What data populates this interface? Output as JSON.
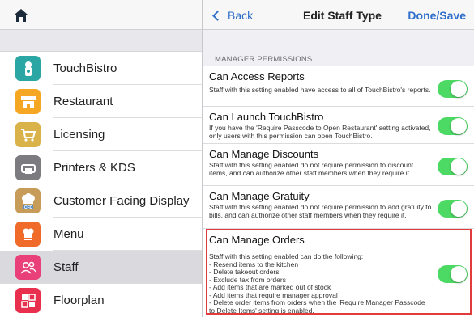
{
  "sidebar": {
    "home_icon": "house-icon",
    "items": [
      {
        "label": "TouchBistro",
        "icon": "chef-badge-icon",
        "color": "#2aa6a5"
      },
      {
        "label": "Restaurant",
        "icon": "store-icon",
        "color": "#f5a623"
      },
      {
        "label": "Licensing",
        "icon": "cart-icon",
        "color": "#d9b24a"
      },
      {
        "label": "Printers & KDS",
        "icon": "printer-icon",
        "color": "#7b7b80"
      },
      {
        "label": "Customer Facing Display",
        "icon": "cfd-chef-icon",
        "color": "#c79b58"
      },
      {
        "label": "Menu",
        "icon": "menu-chef-icon",
        "color": "#f06a2a"
      },
      {
        "label": "Staff",
        "icon": "staff-icon",
        "color": "#e9407a"
      },
      {
        "label": "Floorplan",
        "icon": "floorplan-icon",
        "color": "#e8304e"
      }
    ],
    "active_index": 6
  },
  "header": {
    "back_label": "Back",
    "title": "Edit Staff Type",
    "done_label": "Done/Save"
  },
  "section": {
    "title": "MANAGER PERMISSIONS"
  },
  "permissions": [
    {
      "title": "Can Access Reports",
      "desc": "Staff with this setting enabled have access to all of TouchBistro's reports.",
      "enabled": true
    },
    {
      "title": "Can Launch TouchBistro",
      "desc": "If you have the 'Require Passcode to Open Restaurant' setting activated, only users with this permission can open TouchBistro.",
      "enabled": true
    },
    {
      "title": "Can Manage Discounts",
      "desc": "Staff with this setting enabled do not require permission to discount items, and can authorize other staff members when they require it.",
      "enabled": true
    },
    {
      "title": "Can Manage Gratuity",
      "desc": "Staff with this setting enabled do not require permission to add gratuity to bills, and can authorize other staff members when they require it.",
      "enabled": true
    },
    {
      "title": "Can Manage Orders",
      "desc": "Staff with this setting enabled can do the following:",
      "enabled": true,
      "bullets": [
        "- Resend items to the kitchen",
        "- Delete takeout orders",
        "- Exclude tax from orders",
        "- Add items that are marked out of stock",
        "- Add items that require manager approval",
        "- Delete order items from orders when the 'Require Manager Passcode to Delete Items' setting is enabled."
      ]
    }
  ],
  "colors": {
    "accent": "#2f6fc9",
    "toggle_on": "#4cd964",
    "highlight": "#e23b3b"
  }
}
